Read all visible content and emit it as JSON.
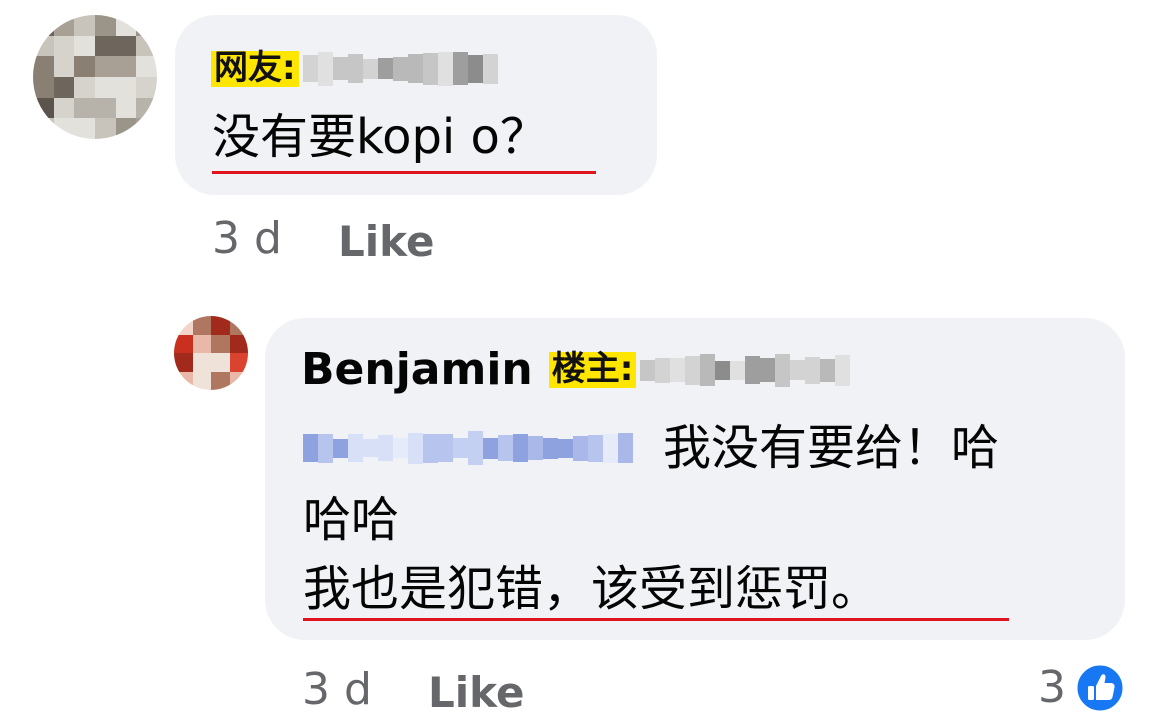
{
  "comment1": {
    "label_tag": "网友:",
    "text": "没有要kopi o？",
    "time": "3 d",
    "like_label": "Like"
  },
  "reply1": {
    "author": "Benjamin",
    "label_tag": "楼主:",
    "text_line1": "我没有要给！哈",
    "text_line2": "哈哈",
    "text_line3": "我也是犯错，该受到惩罚。",
    "time": "3 d",
    "like_label": "Like",
    "reaction_count": "3",
    "reaction_icon": "thumbs-up-icon"
  },
  "colors": {
    "bubble_bg": "#f0f2f5",
    "tag_bg": "#ffe600",
    "underline": "#e0141e",
    "meta_text": "#65676b",
    "like_blue": "#1877f2"
  }
}
